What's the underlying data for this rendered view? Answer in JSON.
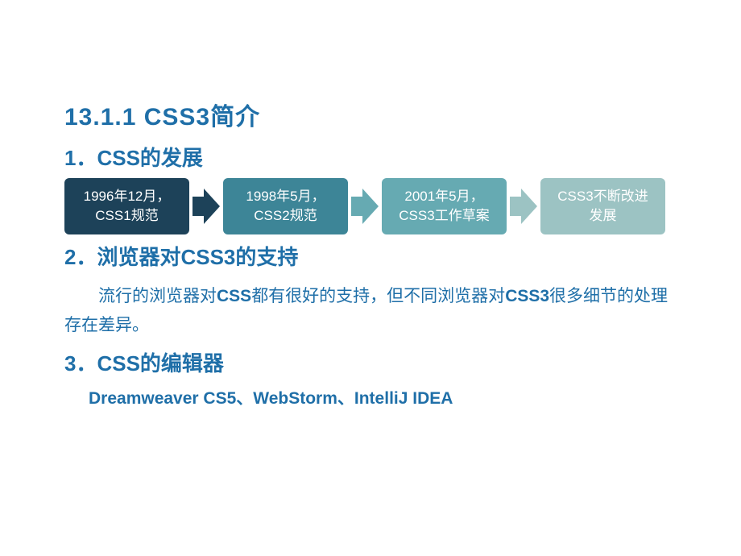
{
  "title": "13.1.1  CSS3简介",
  "section1": {
    "heading": "1．CSS的发展",
    "flow": [
      {
        "line1": "1996年12月，",
        "line2": "CSS1规范"
      },
      {
        "line1": "1998年5月，",
        "line2": "CSS2规范"
      },
      {
        "line1": "2001年5月，",
        "line2": "CSS3工作草案"
      },
      {
        "line1": "CSS3不断改进",
        "line2": "发展"
      }
    ]
  },
  "section2": {
    "heading": "2．浏览器对CSS3的支持",
    "body_pre": "流行的浏览器对",
    "body_bold1": "CSS",
    "body_mid": "都有很好的支持，但不同浏览器对",
    "body_bold2": "CSS3",
    "body_post": "很多细节的处理存在差异。"
  },
  "section3": {
    "heading": "3．CSS的编辑器",
    "editors": "Dreamweaver CS5、WebStorm、IntelliJ IDEA"
  }
}
